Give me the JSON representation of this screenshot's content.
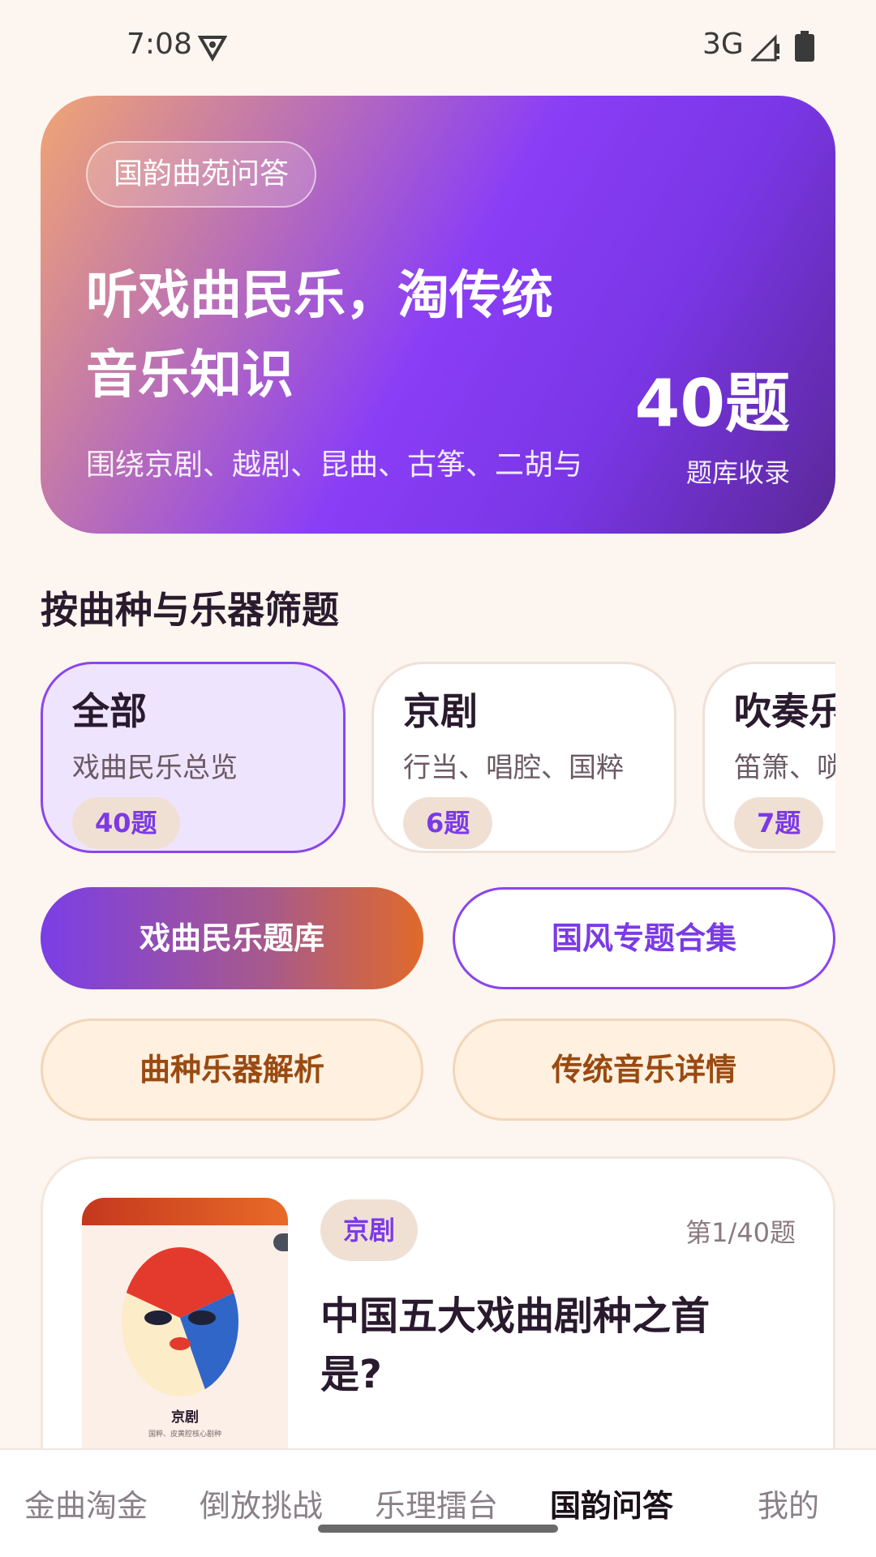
{
  "status_bar": {
    "time": "7:08",
    "network": "3G",
    "vpn_icon": "vpn-key-icon",
    "signal_icon": "signal-icon",
    "battery_icon": "battery-icon"
  },
  "hero": {
    "tag": "国韵曲苑问答",
    "title": "听戏曲民乐，淘传统音乐知识",
    "subtitle": "围绕京剧、越剧、昆曲、古筝、二胡与",
    "count": "40题",
    "count_label": "题库收录"
  },
  "filter": {
    "section_title": "按曲种与乐器筛题",
    "items": [
      {
        "name": "全部",
        "desc": "戏曲民乐总览",
        "count": "40题",
        "active": true
      },
      {
        "name": "京剧",
        "desc": "行当、唱腔、国粹",
        "count": "6题",
        "active": false
      },
      {
        "name": "吹奏乐",
        "desc": "笛箫、唢呐",
        "count": "7题",
        "active": false
      }
    ]
  },
  "actions": {
    "primary": "戏曲民乐题库",
    "outline": "国风专题合集",
    "warm1": "曲种乐器解析",
    "warm2": "传统音乐详情"
  },
  "question": {
    "thumb_title": "京剧",
    "thumb_caption": "国粹、皮黄腔核心剧种",
    "tag": "京剧",
    "progress": "第1/40题",
    "title": "中国五大戏曲剧种之首是?"
  },
  "nav": {
    "items": [
      {
        "label": "金曲淘金",
        "active": false
      },
      {
        "label": "倒放挑战",
        "active": false
      },
      {
        "label": "乐理擂台",
        "active": false
      },
      {
        "label": "国韵问答",
        "active": true
      },
      {
        "label": "我的",
        "active": false
      }
    ]
  },
  "colors": {
    "accent": "#8a45ee",
    "background": "#fdf5ef",
    "warm": "#9a4a10"
  }
}
